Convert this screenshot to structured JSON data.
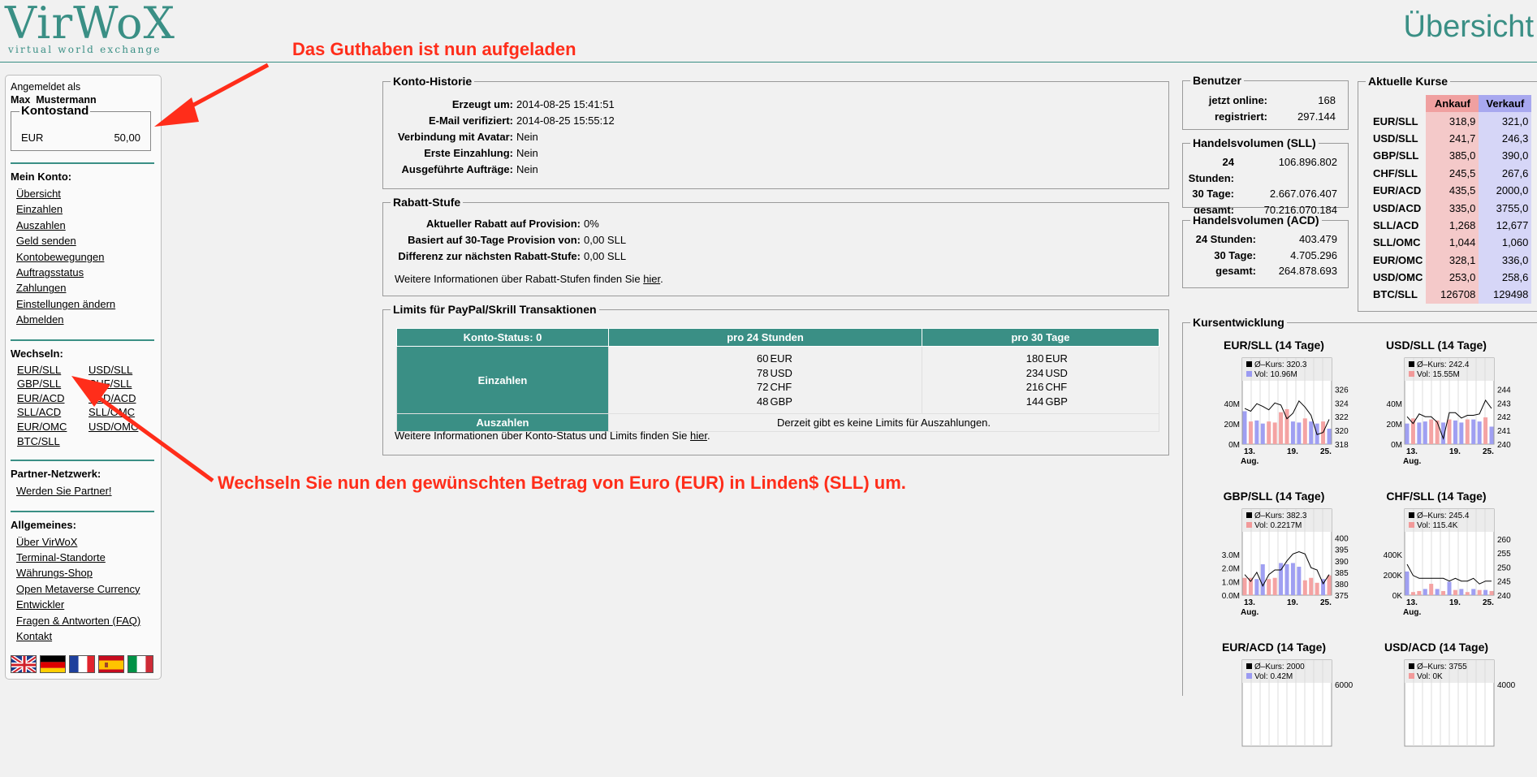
{
  "header": {
    "logo_text": "VirWoX",
    "logo_sub": "virtual world exchange",
    "page_title": "Übersicht"
  },
  "annotations": {
    "top": "Das Guthaben ist nun aufgeladen",
    "bottom": "Wechseln Sie nun den gewünschten Betrag von Euro (EUR) in Linden$ (SLL) um."
  },
  "sidebar": {
    "logged_in_label": "Angemeldet als",
    "username": "Max_Mustermann",
    "balance_title": "Kontostand",
    "balance_currency": "EUR",
    "balance_amount": "50,00",
    "account_heading": "Mein Konto:",
    "account_links": [
      "Übersicht",
      "Einzahlen",
      "Auszahlen",
      "Geld senden",
      "Kontobewegungen",
      "Auftragsstatus",
      "Zahlungen",
      "Einstellungen ändern",
      "Abmelden"
    ],
    "exchange_heading": "Wechseln:",
    "exchange_links": [
      "EUR/SLL",
      "USD/SLL",
      "GBP/SLL",
      "CHF/SLL",
      "EUR/ACD",
      "USD/ACD",
      "SLL/ACD",
      "SLL/OMC",
      "EUR/OMC",
      "USD/OMC",
      "BTC/SLL"
    ],
    "partner_heading": "Partner-Netzwerk:",
    "partner_link": "Werden Sie Partner!",
    "general_heading": "Allgemeines:",
    "general_links": [
      "Über VirWoX",
      "Terminal-Standorte",
      "Währungs-Shop",
      "Open Metaverse Currency",
      "Entwickler",
      "Fragen & Antworten (FAQ)",
      "Kontakt"
    ]
  },
  "history": {
    "title": "Konto-Historie",
    "rows": [
      {
        "k": "Erzeugt um:",
        "v": "2014-08-25 15:41:51"
      },
      {
        "k": "E-Mail verifiziert:",
        "v": "2014-08-25 15:55:12"
      },
      {
        "k": "Verbindung mit Avatar:",
        "v": "Nein"
      },
      {
        "k": "Erste Einzahlung:",
        "v": "Nein"
      },
      {
        "k": "Ausgeführte Aufträge:",
        "v": "Nein"
      }
    ]
  },
  "discount": {
    "title": "Rabatt-Stufe",
    "rows": [
      {
        "k": "Aktueller Rabatt auf Provision:",
        "v": "0%"
      },
      {
        "k": "Basiert auf 30-Tage Provision von:",
        "v": "0,00 SLL"
      },
      {
        "k": "Differenz zur nächsten Rabatt-Stufe:",
        "v": "0,00 SLL"
      }
    ],
    "info_text": "Weitere Informationen über Rabatt-Stufen finden Sie",
    "info_link": "hier",
    "info_end": "."
  },
  "limits": {
    "title": "Limits für PayPal/Skrill Transaktionen",
    "col_status": "Konto-Status: 0",
    "col_24h": "pro 24 Stunden",
    "col_30d": "pro 30 Tage",
    "deposit_label": "Einzahlen",
    "deposit_24h": [
      {
        "n": "60",
        "c": "EUR"
      },
      {
        "n": "78",
        "c": "USD"
      },
      {
        "n": "72",
        "c": "CHF"
      },
      {
        "n": "48",
        "c": "GBP"
      }
    ],
    "deposit_30d": [
      {
        "n": "180",
        "c": "EUR"
      },
      {
        "n": "234",
        "c": "USD"
      },
      {
        "n": "216",
        "c": "CHF"
      },
      {
        "n": "144",
        "c": "GBP"
      }
    ],
    "withdraw_label": "Auszahlen",
    "withdraw_text": "Derzeit gibt es keine Limits für Auszahlungen.",
    "info_text": "Weitere Informationen über Konto-Status und Limits finden Sie",
    "info_link": "hier",
    "info_end": "."
  },
  "users": {
    "title": "Benutzer",
    "rows": [
      {
        "k": "jetzt online:",
        "v": "168"
      },
      {
        "k": "registriert:",
        "v": "297.144"
      }
    ]
  },
  "volume_sll": {
    "title": "Handelsvolumen (SLL)",
    "rows": [
      {
        "k": "24 Stunden:",
        "v": "106.896.802"
      },
      {
        "k": "30 Tage:",
        "v": "2.667.076.407"
      },
      {
        "k": "gesamt:",
        "v": "70.216.070.184"
      }
    ]
  },
  "volume_acd": {
    "title": "Handelsvolumen (ACD)",
    "rows": [
      {
        "k": "24 Stunden:",
        "v": "403.479"
      },
      {
        "k": "30 Tage:",
        "v": "4.705.296"
      },
      {
        "k": "gesamt:",
        "v": "264.878.693"
      }
    ]
  },
  "rates": {
    "title": "Aktuelle Kurse",
    "bid_label": "Ankauf",
    "ask_label": "Verkauf",
    "rows": [
      {
        "pair": "EUR/SLL",
        "bid": "318,9",
        "ask": "321,0"
      },
      {
        "pair": "USD/SLL",
        "bid": "241,7",
        "ask": "246,3"
      },
      {
        "pair": "GBP/SLL",
        "bid": "385,0",
        "ask": "390,0"
      },
      {
        "pair": "CHF/SLL",
        "bid": "245,5",
        "ask": "267,6"
      },
      {
        "pair": "EUR/ACD",
        "bid": "435,5",
        "ask": "2000,0"
      },
      {
        "pair": "USD/ACD",
        "bid": "335,0",
        "ask": "3755,0"
      },
      {
        "pair": "SLL/ACD",
        "bid": "1,268",
        "ask": "12,677"
      },
      {
        "pair": "SLL/OMC",
        "bid": "1,044",
        "ask": "1,060"
      },
      {
        "pair": "EUR/OMC",
        "bid": "328,1",
        "ask": "336,0"
      },
      {
        "pair": "USD/OMC",
        "bid": "253,0",
        "ask": "258,6"
      },
      {
        "pair": "BTC/SLL",
        "bid": "126708",
        "ask": "129498"
      }
    ]
  },
  "trend": {
    "title": "Kursentwicklung"
  },
  "colors": {
    "teal": "#3a8f85",
    "annotation": "#ff2d1a",
    "bid": "#f4c9c9",
    "ask": "#d6d6f7"
  },
  "chart_data": [
    {
      "type": "line",
      "title": "EUR/SLL (14 Tage)",
      "legend_rate": "Ø–Kurs: 320.3",
      "legend_vol": "Vol: 10.96M",
      "yticks_right": [
        "326",
        "324",
        "322",
        "320",
        "318"
      ],
      "yrange_right": [
        318,
        327
      ],
      "yticks_left": [
        "40M",
        "20M",
        "0M"
      ],
      "yrange_left": [
        0,
        60
      ],
      "xticks": [
        "13.",
        "19.",
        "25."
      ],
      "xsub": "Aug.",
      "rate": [
        323.2,
        322.8,
        323.9,
        323.5,
        323.0,
        324.0,
        323.7,
        321.7,
        322.5,
        324.3,
        323.4,
        322.2,
        319.4,
        319.7,
        321.6
      ],
      "volume": [
        32,
        22,
        23,
        20,
        22,
        21,
        31,
        34,
        22,
        21,
        25,
        22,
        20,
        22,
        15
      ],
      "vol_colors": [
        "b",
        "r",
        "b",
        "b",
        "r",
        "r",
        "r",
        "r",
        "b",
        "b",
        "r",
        "b",
        "b",
        "r",
        "b"
      ]
    },
    {
      "type": "line",
      "title": "USD/SLL (14 Tage)",
      "legend_rate": "Ø–Kurs: 242.4",
      "legend_vol": "Vol: 15.55M",
      "yticks_right": [
        "244",
        "243",
        "242",
        "241",
        "240"
      ],
      "yrange_right": [
        240,
        244.5
      ],
      "yticks_left": [
        "40M",
        "20M",
        "0M"
      ],
      "yrange_left": [
        0,
        60
      ],
      "xticks": [
        "13.",
        "19.",
        "25."
      ],
      "xsub": "Aug.",
      "rate": [
        242.0,
        241.5,
        242.2,
        242.0,
        242.0,
        241.6,
        240.4,
        242.3,
        242.3,
        241.9,
        242.1,
        242.1,
        242.2,
        243.2,
        242.6
      ],
      "volume": [
        20,
        25,
        21,
        22,
        24,
        23,
        21,
        24,
        23,
        21,
        24,
        24,
        22,
        26,
        17
      ],
      "vol_colors": [
        "b",
        "r",
        "b",
        "b",
        "r",
        "r",
        "b",
        "r",
        "b",
        "b",
        "r",
        "b",
        "b",
        "r",
        "b"
      ]
    },
    {
      "type": "line",
      "title": "GBP/SLL (14 Tage)",
      "legend_rate": "Ø–Kurs: 382.3",
      "legend_vol": "Vol: 0.2217M",
      "yticks_right": [
        "400",
        "395",
        "390",
        "385",
        "380",
        "375"
      ],
      "yrange_right": [
        375,
        402
      ],
      "yticks_left": [
        "3.0M",
        "2.0M",
        "1.0M",
        "0.0M"
      ],
      "yrange_left": [
        0,
        5
      ],
      "xticks": [
        "13.",
        "19.",
        "25."
      ],
      "xsub": "Aug.",
      "rate": [
        384,
        381,
        385,
        379,
        384,
        386,
        386,
        390,
        393,
        394,
        393,
        387,
        386,
        380,
        384
      ],
      "volume": [
        1.4,
        1.4,
        1.3,
        2.5,
        1.3,
        1.4,
        2.6,
        2.5,
        2.6,
        2.3,
        1.2,
        1.4,
        1.0,
        1.3,
        1.6
      ],
      "vol_colors": [
        "r",
        "r",
        "b",
        "b",
        "r",
        "r",
        "b",
        "b",
        "b",
        "b",
        "r",
        "r",
        "r",
        "b",
        "r"
      ]
    },
    {
      "type": "line",
      "title": "CHF/SLL (14 Tage)",
      "legend_rate": "Ø–Kurs: 245.4",
      "legend_vol": "Vol: 115.4K",
      "yticks_right": [
        "260",
        "255",
        "250",
        "245",
        "240"
      ],
      "yrange_right": [
        240,
        262
      ],
      "yticks_left": [
        "400K",
        "200K",
        "0K"
      ],
      "yrange_left": [
        0,
        600
      ],
      "xticks": [
        "13.",
        "19.",
        "25."
      ],
      "xsub": "Aug.",
      "rate": [
        251,
        247,
        246,
        246,
        246,
        246,
        246,
        245,
        246,
        245,
        245,
        246,
        244,
        245,
        245
      ],
      "volume": [
        230,
        30,
        40,
        60,
        110,
        60,
        40,
        130,
        50,
        60,
        30,
        60,
        50,
        50,
        40
      ],
      "vol_colors": [
        "b",
        "r",
        "r",
        "b",
        "r",
        "b",
        "r",
        "b",
        "r",
        "b",
        "r",
        "b",
        "r",
        "b",
        "r"
      ]
    },
    {
      "type": "line",
      "title": "EUR/ACD (14 Tage)",
      "legend_rate": "Ø–Kurs: 2000",
      "legend_vol": "Vol: 0.42M",
      "yticks_right": [
        "6000"
      ],
      "yrange_right": [
        0,
        6000
      ],
      "yticks_left": [],
      "yrange_left": [
        0,
        1
      ],
      "xticks": [],
      "xsub": "",
      "rate": [],
      "volume": [],
      "vol_colors": []
    },
    {
      "type": "line",
      "title": "USD/ACD (14 Tage)",
      "legend_rate": "Ø–Kurs: 3755",
      "legend_vol": "Vol: 0K",
      "yticks_right": [
        "4000"
      ],
      "yrange_right": [
        0,
        4000
      ],
      "yticks_left": [],
      "yrange_left": [
        0,
        1
      ],
      "xticks": [],
      "xsub": "",
      "rate": [],
      "volume": [],
      "vol_colors": []
    }
  ]
}
